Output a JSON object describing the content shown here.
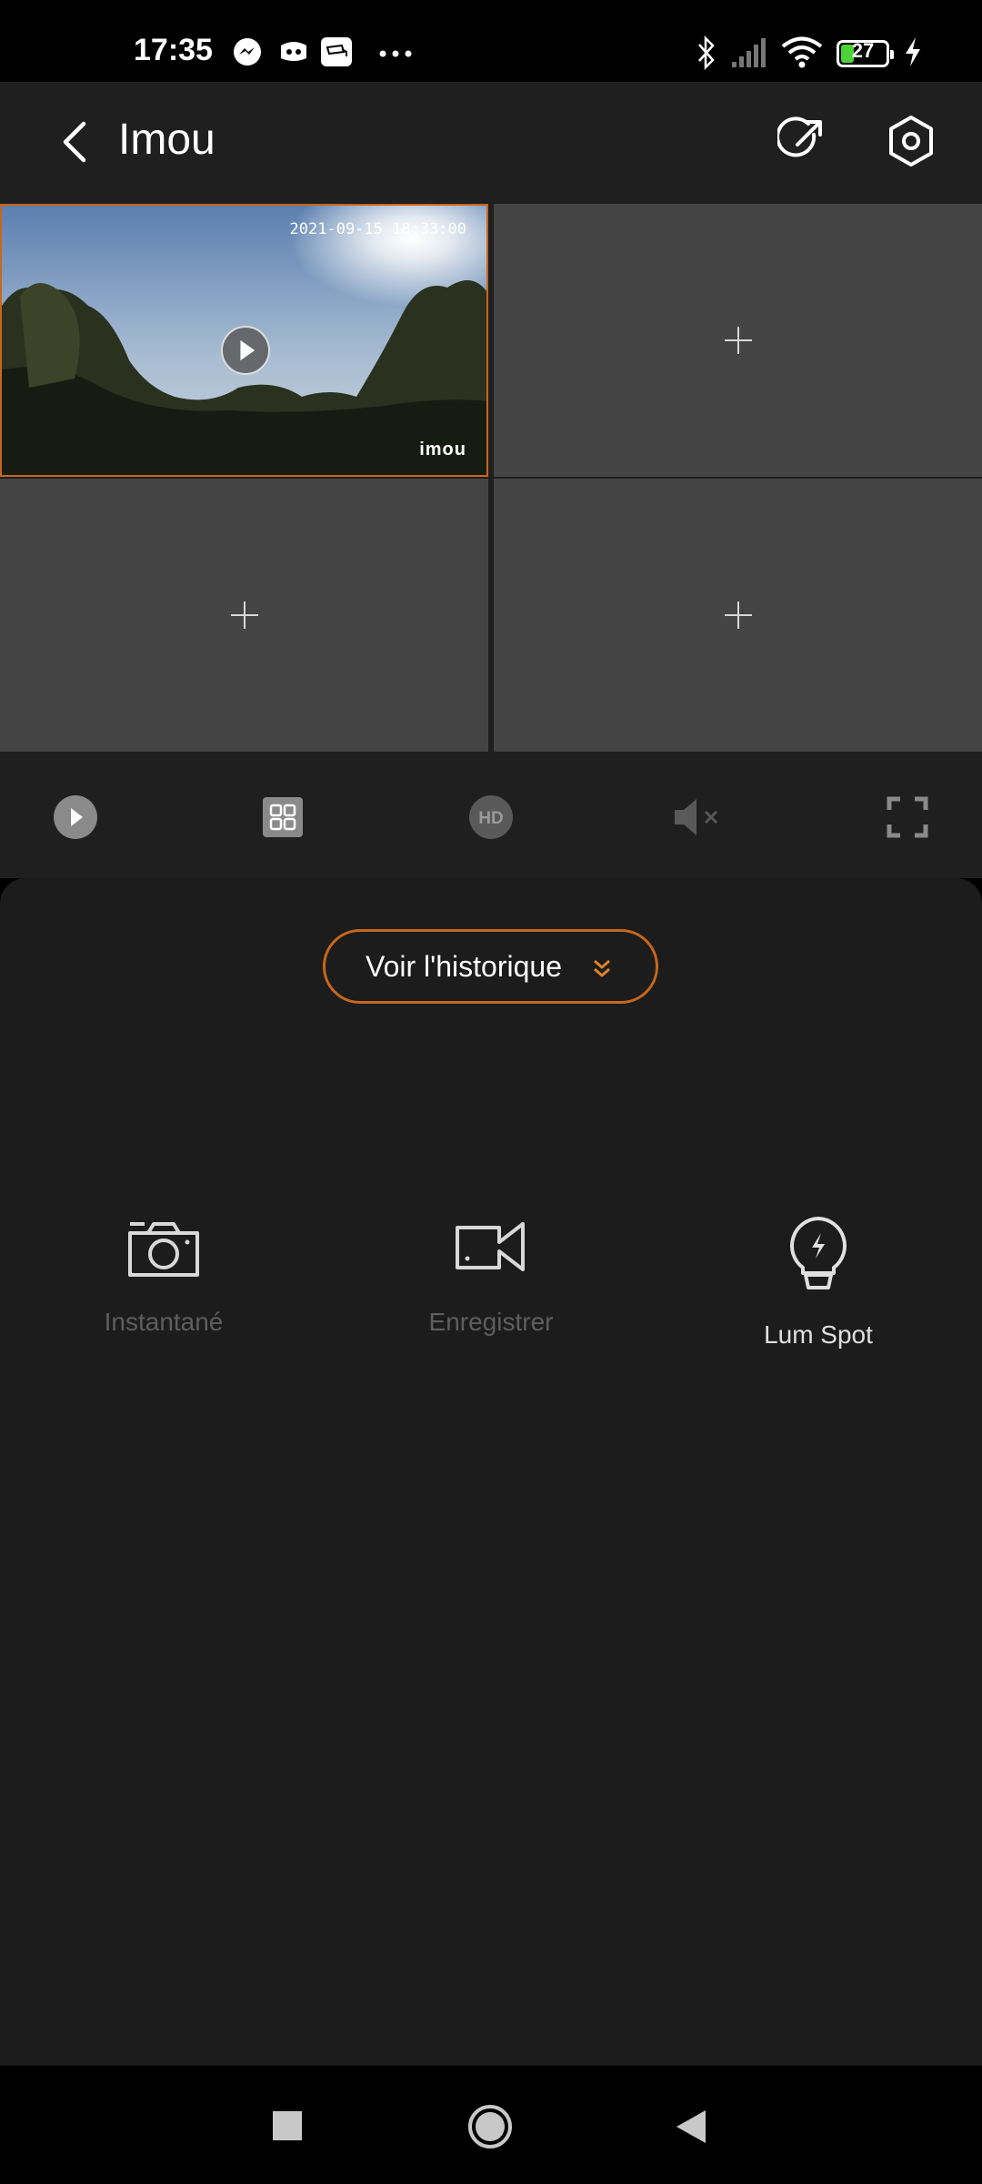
{
  "status_bar": {
    "time": "17:35",
    "notification_icons": [
      "messenger-icon",
      "discord-icon",
      "cctv-app-icon",
      "more-dots-icon"
    ],
    "system_icons": [
      "bluetooth-icon",
      "cellular-signal-icon",
      "wifi-icon",
      "battery-icon",
      "charging-bolt-icon"
    ],
    "battery_level": "27"
  },
  "header": {
    "title": "Imou",
    "icons": [
      "back-arrow-icon",
      "share-icon",
      "settings-icon"
    ]
  },
  "video_grid": {
    "active_channel": {
      "timestamp": "2021-09-15 18:33:00",
      "watermark": "imou",
      "state": "paused"
    },
    "empty_slots": 3
  },
  "controls": {
    "items": [
      "play-icon",
      "grid-layout-icon",
      "hd-icon",
      "mute-icon",
      "fullscreen-icon"
    ]
  },
  "history_button": {
    "label": "Voir l'historique"
  },
  "actions": [
    {
      "label": "Instantané",
      "icon": "camera-icon",
      "enabled": false
    },
    {
      "label": "Enregistrer",
      "icon": "video-record-icon",
      "enabled": false
    },
    {
      "label": "Lum Spot",
      "icon": "spotlight-bulb-icon",
      "enabled": true
    }
  ],
  "nav_bar": {
    "items": [
      "recents-square-icon",
      "home-circle-icon",
      "back-triangle-icon"
    ]
  },
  "colors": {
    "accent": "#c8671b",
    "background": "#1c1c1c",
    "header_bg": "#1f1f1f",
    "empty_cell": "#444444",
    "disabled_text": "#5e5e5e"
  }
}
